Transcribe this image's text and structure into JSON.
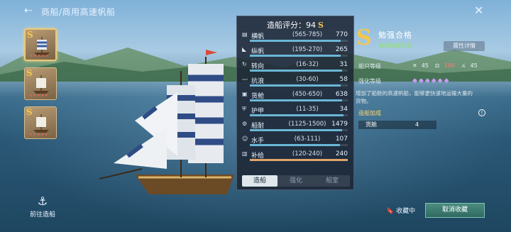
{
  "header": {
    "breadcrumb": "商船/商用高速帆船"
  },
  "thumbnails": [
    {
      "grade": "S",
      "active": true
    },
    {
      "grade": "S",
      "active": false
    },
    {
      "grade": "S",
      "active": false
    }
  ],
  "go_build_label": "前往造船",
  "panel": {
    "title": "造船评分：",
    "score": "94",
    "score_grade": "S",
    "stats": [
      {
        "icon": "horizontal-sail-icon",
        "name": "横帆",
        "range": "(565-785)",
        "value": "770",
        "fill": 0.93
      },
      {
        "icon": "longitudinal-sail-icon",
        "name": "纵帆",
        "range": "(195-270)",
        "value": "265",
        "fill": 0.93
      },
      {
        "icon": "turning-icon",
        "name": "转向",
        "range": "(16-32)",
        "value": "31",
        "fill": 0.94
      },
      {
        "icon": "wave-resistance-icon",
        "name": "抗浪",
        "range": "(30-60)",
        "value": "58",
        "fill": 0.93
      },
      {
        "icon": "cargo-icon",
        "name": "货舱",
        "range": "(450-650)",
        "value": "638",
        "fill": 0.94
      },
      {
        "icon": "armor-icon",
        "name": "护甲",
        "range": "(11-35)",
        "value": "34",
        "fill": 0.96
      },
      {
        "icon": "durability-icon",
        "name": "船耐",
        "range": "(1125-1500)",
        "value": "1479",
        "fill": 0.94
      },
      {
        "icon": "sailor-icon",
        "name": "水手",
        "range": "(63-111)",
        "value": "107",
        "fill": 0.92
      },
      {
        "icon": "supply-icon",
        "name": "补给",
        "range": "(120-240)",
        "value": "240",
        "fill": 1.0
      }
    ],
    "tabs": [
      "造船",
      "强化",
      "船室"
    ]
  },
  "info": {
    "grade": "S",
    "name": "勉强合格",
    "subtitle": "商用高速帆船",
    "attr_button": "属性详情",
    "rank_label": "船只等级",
    "rank_vals": [
      "45",
      "100",
      "45"
    ],
    "enhance_label": "强化等级",
    "desc": "增加了船舱的高速帆船，能够更快速地运输大量的货物。",
    "bonus_label": "造船加成",
    "bonus_item": "货舱",
    "bonus_value": "4"
  },
  "actions": {
    "fav_label": "收藏中",
    "cancel_label": "取消收藏"
  }
}
